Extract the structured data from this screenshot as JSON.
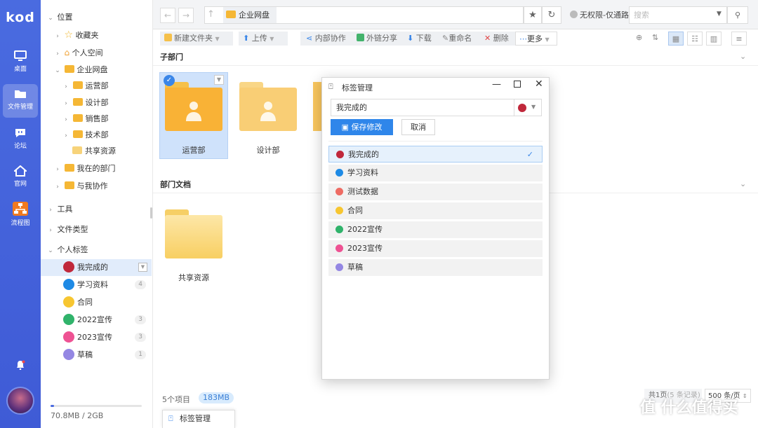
{
  "app": {
    "logo": "kod"
  },
  "rail": [
    {
      "name": "desktop",
      "label": "桌面",
      "icon": "monitor-icon"
    },
    {
      "name": "files",
      "label": "文件管理",
      "icon": "folder-icon",
      "active": true
    },
    {
      "name": "forum",
      "label": "论坛",
      "icon": "chat-icon"
    },
    {
      "name": "website",
      "label": "官网",
      "icon": "home-icon"
    },
    {
      "name": "flowchart",
      "label": "流程图",
      "icon": "flowchart-icon"
    }
  ],
  "tree": {
    "location": "位置",
    "favorites": "收藏夹",
    "personal_space": "个人空间",
    "enterprise_disk": "企业网盘",
    "depts": [
      "运营部",
      "设计部",
      "销售部",
      "技术部"
    ],
    "shared": "共享资源",
    "my_dept": "我在的部门",
    "cooperate": "与我协作",
    "tools": "工具",
    "file_types": "文件类型",
    "personal_tags": "个人标签",
    "tags": [
      {
        "label": "我完成的",
        "color": "#c0283b",
        "count": ""
      },
      {
        "label": "学习资料",
        "color": "#1e8ae5",
        "count": "4"
      },
      {
        "label": "合同",
        "color": "#f7c631",
        "count": ""
      },
      {
        "label": "2022宣传",
        "color": "#30b36b",
        "count": "3"
      },
      {
        "label": "2023宣传",
        "color": "#ee5293",
        "count": "3"
      },
      {
        "label": "草稿",
        "color": "#9487e3",
        "count": "1"
      }
    ],
    "quota": "70.8MB / 2GB",
    "quota_used_fraction": 0.035
  },
  "header": {
    "crumb": "企业网盘",
    "permission": "无权限-仅通路",
    "search_placeholder": "搜索"
  },
  "toolbar": {
    "new_folder": "新建文件夹",
    "upload": "上传",
    "internal_collab": "内部协作",
    "share_link": "外链分享",
    "download": "下载",
    "rename": "重命名",
    "delete": "删除",
    "more": "更多"
  },
  "content": {
    "sub_dept_title": "子部门",
    "sub_depts": [
      "运营部",
      "设计部"
    ],
    "dept_docs_title": "部门文档",
    "docs": [
      "共享资源"
    ]
  },
  "footer": {
    "items": "5个项目",
    "size": "183MB",
    "pager": "共1页",
    "pager_records": "(5 条记录)",
    "per_page": "500 条/页"
  },
  "taskbar": {
    "label": "标签管理"
  },
  "modal": {
    "title": "标签管理",
    "input_value": "我完成的",
    "selected_color": "#c0283b",
    "save": "保存修改",
    "cancel": "取消",
    "tags": [
      {
        "label": "我完成的",
        "color": "#c0283b",
        "selected": true
      },
      {
        "label": "学习资料",
        "color": "#1e8ae5"
      },
      {
        "label": "测试数据",
        "color": "#ee6b63"
      },
      {
        "label": "合同",
        "color": "#f7c631"
      },
      {
        "label": "2022宣传",
        "color": "#30b36b"
      },
      {
        "label": "2023宣传",
        "color": "#ee5293"
      },
      {
        "label": "草稿",
        "color": "#9487e3"
      }
    ]
  },
  "watermark": "值 什么值得买"
}
